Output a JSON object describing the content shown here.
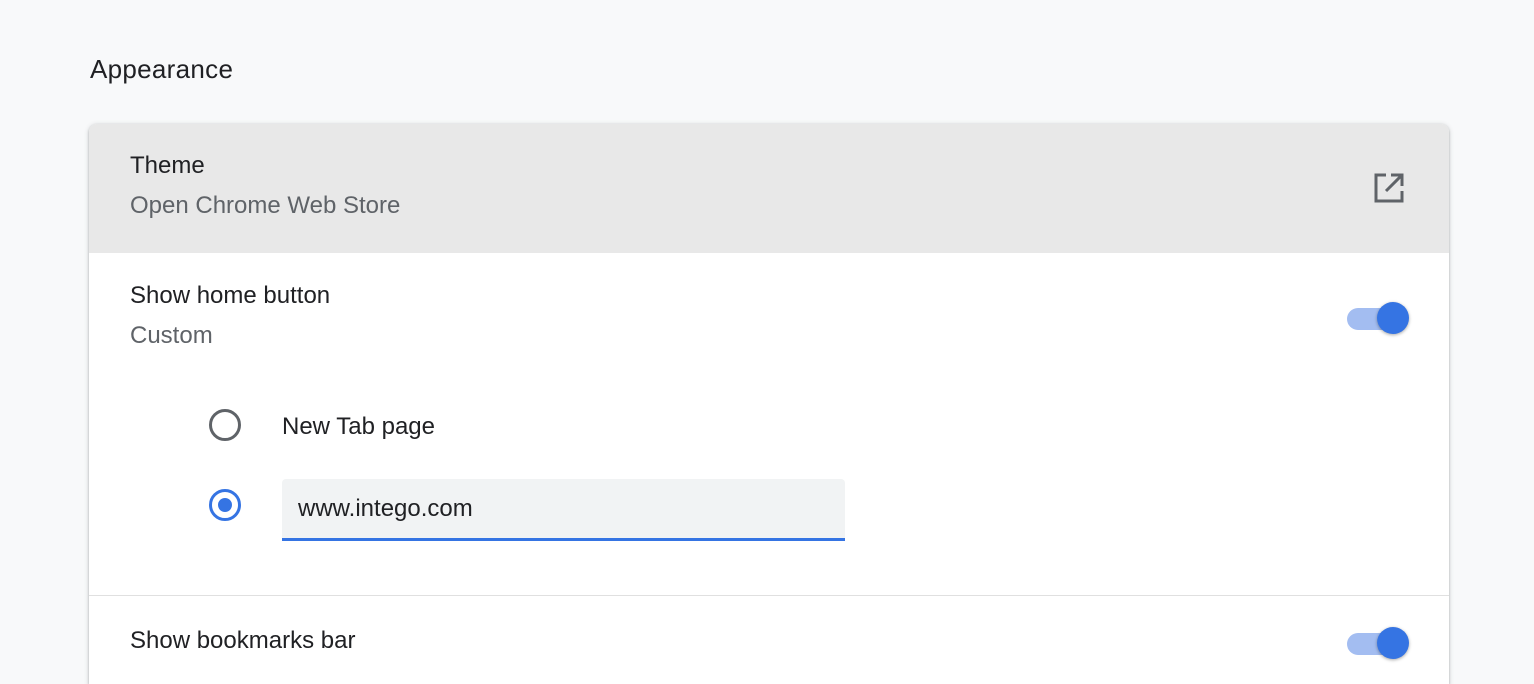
{
  "section": {
    "title": "Appearance"
  },
  "theme": {
    "label": "Theme",
    "sublabel": "Open Chrome Web Store",
    "icon": "open-in-new-icon"
  },
  "home_button": {
    "label": "Show home button",
    "sublabel": "Custom",
    "enabled": true,
    "options": [
      {
        "label": "New Tab page",
        "selected": false
      },
      {
        "value": "www.intego.com",
        "selected": true
      }
    ]
  },
  "bookmarks_bar": {
    "label": "Show bookmarks bar",
    "enabled": true
  },
  "colors": {
    "accent": "#3574e3",
    "toggle_track": "#a3bdf1",
    "theme_row_bg": "#e8e8e8",
    "secondary_text": "#5f6368"
  }
}
